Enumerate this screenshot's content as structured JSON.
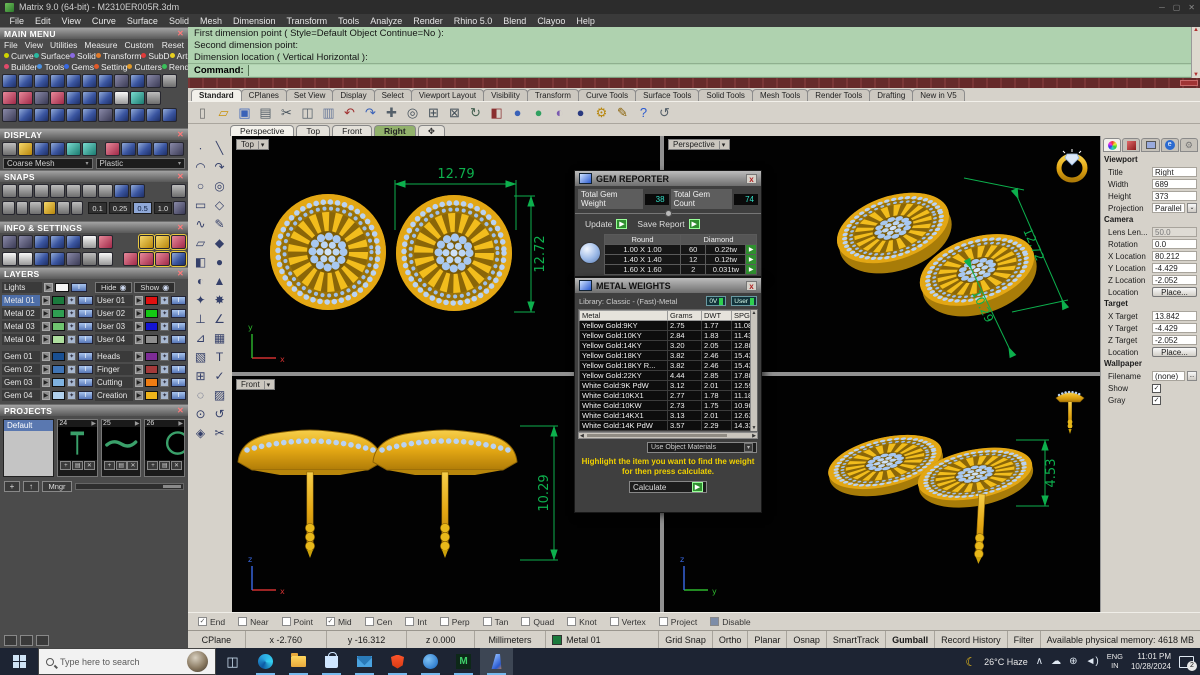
{
  "window": {
    "title": "Matrix 9.0 (64-bit) - M2310ER005R.3dm"
  },
  "menu_bar": {
    "items": [
      "File",
      "Edit",
      "View",
      "Curve",
      "Surface",
      "Solid",
      "Mesh",
      "Dimension",
      "Transform",
      "Tools",
      "Analyze",
      "Render",
      "Rhino 5.0",
      "Blend",
      "Clayoo",
      "Help"
    ]
  },
  "command_area": {
    "lines": [
      "First dimension point ( Style=Default  Object  Continue=No ):",
      "Second dimension point:",
      "Dimension location ( Vertical  Horizontal ):"
    ],
    "prompt_label": "Command:"
  },
  "toolbar_tabs": {
    "items": [
      {
        "label": "Standard",
        "cls": "active"
      },
      {
        "label": "CPlanes"
      },
      {
        "label": "Set View"
      },
      {
        "label": "Display"
      },
      {
        "label": "Select"
      },
      {
        "label": "Viewport Layout"
      },
      {
        "label": "Visibility"
      },
      {
        "label": "Transform"
      },
      {
        "label": "Curve Tools"
      },
      {
        "label": "Surface Tools"
      },
      {
        "label": "Solid Tools"
      },
      {
        "label": "Mesh Tools"
      },
      {
        "label": "Render Tools"
      },
      {
        "label": "Drafting"
      },
      {
        "label": "New in V5"
      }
    ]
  },
  "toolbar_icons": [
    {
      "name": "new-file-icon",
      "g": "▯",
      "c": "#6e6e6e"
    },
    {
      "name": "open-file-icon",
      "g": "▱",
      "c": "#c8920a"
    },
    {
      "name": "save-icon",
      "g": "▣",
      "c": "#3a62b8"
    },
    {
      "name": "print-icon",
      "g": "▤",
      "c": "#55606a"
    },
    {
      "name": "cut-icon",
      "g": "✂",
      "c": "#44505a"
    },
    {
      "name": "copy-icon",
      "g": "◫",
      "c": "#55606a"
    },
    {
      "name": "paste-icon",
      "g": "▥",
      "c": "#6a7a9a"
    },
    {
      "name": "undo-icon",
      "g": "↶",
      "c": "#a03030"
    },
    {
      "name": "redo-icon",
      "g": "↷",
      "c": "#3a62b8"
    },
    {
      "name": "pan-icon",
      "g": "✚",
      "c": "#55606a"
    },
    {
      "name": "zoom-icon",
      "g": "◎",
      "c": "#44505a"
    },
    {
      "name": "zoom-window-icon",
      "g": "⊞",
      "c": "#44505a"
    },
    {
      "name": "zoom-extents-icon",
      "g": "⊠",
      "c": "#44505a"
    },
    {
      "name": "rotate-view-icon",
      "g": "↻",
      "c": "#446050"
    },
    {
      "name": "viewport-layout-icon",
      "g": "◧",
      "c": "#8a3030"
    },
    {
      "name": "shaded-view-icon",
      "g": "●",
      "c": "#3a62b8"
    },
    {
      "name": "rendered-view-icon",
      "g": "●",
      "c": "#30a060"
    },
    {
      "name": "ghosted-view-icon",
      "g": "◐",
      "c": "#7a5ab0"
    },
    {
      "name": "raytrace-icon",
      "g": "●",
      "c": "#2a3a80"
    },
    {
      "name": "options-icon",
      "g": "⚙",
      "c": "#b8860b"
    },
    {
      "name": "annotate-icon",
      "g": "✎",
      "c": "#8a6206"
    },
    {
      "name": "help-icon",
      "g": "?",
      "c": "#2a5ad0"
    },
    {
      "name": "history-icon",
      "g": "↺",
      "c": "#55606a"
    }
  ],
  "viewport_tabs": {
    "items": [
      {
        "label": "Perspective"
      },
      {
        "label": "Top"
      },
      {
        "label": "Front"
      },
      {
        "label": "Right",
        "cls": "active"
      },
      {
        "label": "✥"
      }
    ]
  },
  "drawbar_icons": [
    {
      "name": "point-tool-icon",
      "g": "∙"
    },
    {
      "name": "line-tool-icon",
      "g": "╲"
    },
    {
      "name": "arc-tool-icon",
      "g": "◠"
    },
    {
      "name": "curve-tool-icon",
      "g": "↷"
    },
    {
      "name": "circle-tool-icon",
      "g": "○"
    },
    {
      "name": "ellipse-tool-icon",
      "g": "◎"
    },
    {
      "name": "rectangle-tool-icon",
      "g": "▭"
    },
    {
      "name": "polygon-tool-icon",
      "g": "◇"
    },
    {
      "name": "freeform-curve-icon",
      "g": "∿"
    },
    {
      "name": "sketch-tool-icon",
      "g": "✎"
    },
    {
      "name": "plane-tool-icon",
      "g": "▱"
    },
    {
      "name": "solid-tool-icon",
      "g": "◆"
    },
    {
      "name": "box-tool-icon",
      "g": "◧"
    },
    {
      "name": "sphere-tool-icon",
      "g": "●"
    },
    {
      "name": "cylinder-tool-icon",
      "g": "◐"
    },
    {
      "name": "cone-tool-icon",
      "g": "▲"
    },
    {
      "name": "gem-tool-icon",
      "g": "✦"
    },
    {
      "name": "burst-tool-icon",
      "g": "✸"
    },
    {
      "name": "perp-tool-icon",
      "g": "⊥"
    },
    {
      "name": "angle-tool-icon",
      "g": "∠"
    },
    {
      "name": "triangle-tool-icon",
      "g": "⊿"
    },
    {
      "name": "array-tool-icon",
      "g": "▦"
    },
    {
      "name": "hatch-tool-icon",
      "g": "▧"
    },
    {
      "name": "text-tool-icon",
      "g": "T"
    },
    {
      "name": "grid-tool-icon",
      "g": "⊞"
    },
    {
      "name": "check-tool-icon",
      "g": "✓"
    },
    {
      "name": "lasso-tool-icon",
      "g": "◌"
    },
    {
      "name": "mesh-tool-icon",
      "g": "▨"
    },
    {
      "name": "center-tool-icon",
      "g": "⊙"
    },
    {
      "name": "rotate-tool-icon",
      "g": "↺"
    },
    {
      "name": "scale-tool-icon",
      "g": "◈"
    },
    {
      "name": "trim-tool-icon",
      "g": "✂"
    }
  ],
  "viewports": {
    "top_label": "Top",
    "perspective_label": "Perspective",
    "front_label": "Front",
    "dim_top_width": "12.79",
    "dim_top_height": "12.72",
    "dim_front_height": "10.29",
    "dim_right_height": "4.53",
    "dim_persp_a": "12.72",
    "dim_persp_b": "10.29",
    "axis_x": "x",
    "axis_y": "y",
    "axis_z": "z"
  },
  "main_menu": {
    "title": "MAIN MENU",
    "tabs": [
      "File",
      "View",
      "Utilities",
      "Measure",
      "Custom"
    ],
    "reset_label": "Reset",
    "cats1": [
      {
        "label": "Curve",
        "dot": "#cfd400"
      },
      {
        "label": "Surface",
        "dot": "#2ab8a0"
      },
      {
        "label": "Solid",
        "dot": "#8a6ae0"
      },
      {
        "label": "Transform",
        "dot": "#e07a2a"
      },
      {
        "label": "SubD",
        "dot": "#e03a3a"
      },
      {
        "label": "Art",
        "dot": "#e8d020"
      }
    ],
    "cats2": [
      {
        "label": "Builder",
        "dot": "#e04a6a"
      },
      {
        "label": "Tools",
        "dot": "#4a90e0"
      },
      {
        "label": "Gems",
        "dot": "#3a6ae0"
      },
      {
        "label": "Setting",
        "dot": "#e05a2a"
      },
      {
        "label": "Cutters",
        "dot": "#e09a2a"
      },
      {
        "label": "Render",
        "dot": "#3ac05a"
      }
    ]
  },
  "display_panel": {
    "title": "DISPLAY",
    "mesh_dropdown": "Coarse Mesh",
    "material_dropdown": "Plastic"
  },
  "snaps_panel": {
    "title": "SNAPS",
    "grid_values": [
      {
        "v": "0.1"
      },
      {
        "v": "0.25"
      },
      {
        "v": "0.5",
        "cls": "on"
      },
      {
        "v": "1.0"
      }
    ]
  },
  "info_settings_panel": {
    "title": "INFO & SETTINGS"
  },
  "layers_panel": {
    "title": "LAYERS",
    "lights_label": "Lights",
    "hide_label": "Hide",
    "show_label": "Show",
    "left": [
      {
        "name": "Metal 01",
        "color": "#1b7a3d",
        "cls": "selected"
      },
      {
        "name": "Metal 02",
        "color": "#2f9e52"
      },
      {
        "name": "Metal 03",
        "color": "#6fc46f"
      },
      {
        "name": "Metal 04",
        "color": "#aede9e"
      },
      {
        "name": "Gem 01",
        "color": "#194f91",
        "gap": "gap"
      },
      {
        "name": "Gem 02",
        "color": "#3f74b5"
      },
      {
        "name": "Gem 03",
        "color": "#7fb2e0"
      },
      {
        "name": "Gem 04",
        "color": "#b0d0ec"
      }
    ],
    "right": [
      {
        "name": "User 01",
        "color": "#e01010"
      },
      {
        "name": "User 02",
        "color": "#14c814"
      },
      {
        "name": "User 03",
        "color": "#1414d2"
      },
      {
        "name": "User 04",
        "color": "#8e8e8e"
      },
      {
        "name": "Heads",
        "color": "#7d2c96",
        "gap": "gap"
      },
      {
        "name": "Finger",
        "color": "#a33a3a"
      },
      {
        "name": "Cutting",
        "color": "#ef7d13"
      },
      {
        "name": "Creation",
        "color": "#efb41a"
      }
    ]
  },
  "projects_panel": {
    "title": "PROJECTS",
    "items": [
      {
        "label": "Default"
      }
    ],
    "thumbs": [
      {
        "num": "24"
      },
      {
        "num": "25"
      },
      {
        "num": "26"
      }
    ],
    "add_label": "+",
    "up_label": "↑",
    "manager_label": "Mngr"
  },
  "gem_reporter": {
    "title": "GEM REPORTER",
    "weight_label": "Total Gem Weight",
    "weight_value": "38",
    "count_label": "Total Gem Count",
    "count_value": "74",
    "update_label": "Update",
    "save_label": "Save Report",
    "col_shape": "Round",
    "col_type": "Diamond",
    "rows": [
      {
        "size": "1.00 X 1.00",
        "count": "60",
        "carat": "0.22tw"
      },
      {
        "size": "1.40 X 1.40",
        "count": "12",
        "carat": "0.12tw"
      },
      {
        "size": "1.60 X 1.60",
        "count": "2",
        "carat": "0.031tw"
      }
    ]
  },
  "metal_weights": {
    "title": "METAL WEIGHTS",
    "library_label": "Library: Classic - (Fast)-Metal",
    "toggle1": "0V",
    "toggle2": "User",
    "headers": [
      "Metal",
      "Grams",
      "DWT",
      "SPG"
    ],
    "rows": [
      {
        "m": "Yellow Gold:9KY",
        "g": "2.75",
        "d": "1.77",
        "s": "11.08"
      },
      {
        "m": "Yellow Gold:10KY",
        "g": "2.84",
        "d": "1.83",
        "s": "11.43"
      },
      {
        "m": "Yellow Gold:14KY",
        "g": "3.20",
        "d": "2.05",
        "s": "12.88"
      },
      {
        "m": "Yellow Gold:18KY",
        "g": "3.82",
        "d": "2.46",
        "s": "15.43"
      },
      {
        "m": "Yellow Gold:18KY R...",
        "g": "3.82",
        "d": "2.46",
        "s": "15.43"
      },
      {
        "m": "Yellow Gold:22KY",
        "g": "4.44",
        "d": "2.85",
        "s": "17.88"
      },
      {
        "m": "White Gold:9K PdW",
        "g": "3.12",
        "d": "2.01",
        "s": "12.59"
      },
      {
        "m": "White Gold:10KX1",
        "g": "2.77",
        "d": "1.78",
        "s": "11.18"
      },
      {
        "m": "White Gold:10KW",
        "g": "2.73",
        "d": "1.75",
        "s": "10.98"
      },
      {
        "m": "White Gold:14KX1",
        "g": "3.13",
        "d": "2.01",
        "s": "12.63"
      },
      {
        "m": "White Gold:14K PdW",
        "g": "3.57",
        "d": "2.29",
        "s": "14.33"
      }
    ],
    "materials_dropdown": "Use Object Materials",
    "hint_line1": "Highlight the item you want to find the weight",
    "hint_line2": "for then press calculate.",
    "calculate_label": "Calculate"
  },
  "properties_panel": {
    "viewport_title": "Viewport",
    "viewport_rows": [
      [
        "Title",
        "Right"
      ],
      [
        "Width",
        "689"
      ],
      [
        "Height",
        "373"
      ]
    ],
    "projection_label": "Projection",
    "projection_value": "Parallel",
    "camera_title": "Camera",
    "camera_rows": [
      [
        "Lens Len...",
        "50.0",
        "dim"
      ],
      [
        "Rotation",
        "0.0",
        ""
      ],
      [
        "X Location",
        "80.212",
        ""
      ],
      [
        "Y Location",
        "-4.429",
        ""
      ],
      [
        "Z Location",
        "-2.052",
        ""
      ]
    ],
    "location_label": "Location",
    "place_label": "Place...",
    "target_title": "Target",
    "target_rows": [
      [
        "X Target",
        "13.842"
      ],
      [
        "Y Target",
        "-4.429"
      ],
      [
        "Z Target",
        "-2.052"
      ]
    ],
    "wallpaper_title": "Wallpaper",
    "filename_label": "Filename",
    "filename_value": "(none)",
    "browse_label": "...",
    "show_label": "Show",
    "gray_label": "Gray",
    "check_glyph": "✓"
  },
  "osnap_bar": {
    "items": [
      {
        "label": "End",
        "cls": "checked"
      },
      {
        "label": "Near"
      },
      {
        "label": "Point"
      },
      {
        "label": "Mid",
        "cls": "checked"
      },
      {
        "label": "Cen"
      },
      {
        "label": "Int"
      },
      {
        "label": "Perp"
      },
      {
        "label": "Tan"
      },
      {
        "label": "Quad"
      },
      {
        "label": "Knot"
      },
      {
        "label": "Vertex"
      },
      {
        "label": "Project"
      },
      {
        "label": "Disable",
        "cls": "filled"
      }
    ]
  },
  "status_bar": {
    "cells": [
      "CPlane",
      "x -2.760",
      "y -16.312",
      "z 0.000",
      "Millimeters"
    ],
    "layer_name": "Metal 01",
    "layer_color": "#1b7a3d",
    "toggles": [
      {
        "label": "Grid Snap"
      },
      {
        "label": "Ortho"
      },
      {
        "label": "Planar"
      },
      {
        "label": "Osnap"
      },
      {
        "label": "SmartTrack"
      },
      {
        "label": "Gumball",
        "cls": "bold"
      },
      {
        "label": "Record History"
      },
      {
        "label": "Filter"
      }
    ],
    "memory": "Available physical memory: 4618 MB"
  },
  "taskbar": {
    "search_placeholder": "Type here to search",
    "apps": [
      {
        "name": "edge-browser-icon",
        "icon": "ic-edge",
        "state": "run"
      },
      {
        "name": "file-explorer-icon",
        "icon": "ic-folder",
        "state": "run"
      },
      {
        "name": "microsoft-store-icon",
        "icon": "ic-store",
        "state": "run"
      },
      {
        "name": "mail-icon",
        "icon": "ic-mail",
        "state": "run"
      },
      {
        "name": "brave-browser-icon",
        "icon": "ic-brave",
        "state": "run"
      },
      {
        "name": "photos-app-icon",
        "icon": "ic-blue",
        "state": "run"
      },
      {
        "name": "matrix-app-icon",
        "icon": "ic-matrix",
        "state": "run"
      },
      {
        "name": "matrix-active-app-icon",
        "icon": "ic-active",
        "state": "active"
      }
    ],
    "weather": "26°C Haze",
    "lang_line1": "ENG",
    "lang_line2": "IN",
    "time": "11:01 PM",
    "date": "10/28/2024",
    "notification_count": "2"
  },
  "colors": {
    "command_bg": "#afd2af",
    "dimension_green": "#0db04d",
    "gold": "#e3a714",
    "gem_blue": "#aac9ef",
    "selection_blue": "#4d6ea8",
    "active_tab_green": "#92b26c"
  }
}
